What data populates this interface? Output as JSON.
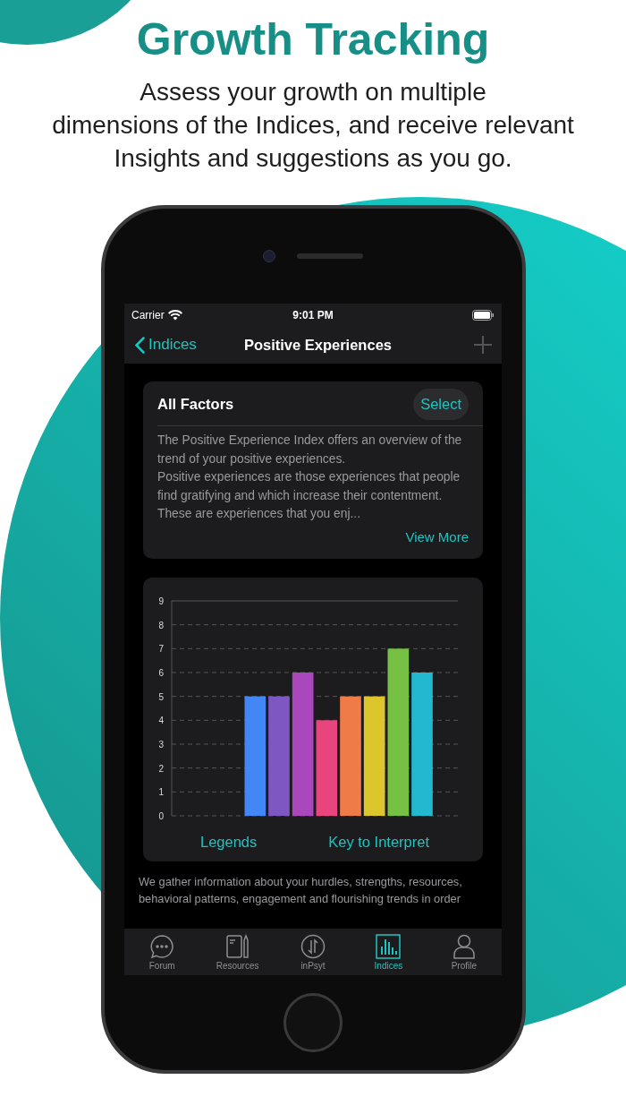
{
  "headline": "Growth Tracking",
  "subtitle_lines": [
    "Assess your growth on multiple",
    "dimensions of the Indices, and receive relevant",
    "Insights and suggestions as you go."
  ],
  "status_bar": {
    "carrier": "Carrier",
    "time": "9:01 PM"
  },
  "nav_bar": {
    "back": "Indices",
    "title": "Positive Experiences",
    "add_disabled": true
  },
  "factors_card": {
    "title": "All Factors",
    "select": "Select",
    "paragraphs": [
      "The Positive Experience Index offers an overview of the trend of your positive experiences.",
      "Positive experiences are those experiences that people find gratifying and which increase their contentment. These are experiences that you enj..."
    ],
    "view_more": "View More"
  },
  "chart_card": {
    "chart_data": {
      "type": "bar",
      "grid": true,
      "ylim": [
        0,
        9
      ],
      "yticks": [
        0,
        1,
        2,
        3,
        4,
        5,
        6,
        7,
        8,
        9
      ],
      "series": [
        {
          "color": "#4287f5",
          "values": [
            null,
            null,
            null,
            5,
            null,
            null,
            null,
            null,
            null,
            null,
            null,
            null
          ]
        },
        {
          "color": "#7e57c2",
          "values": [
            null,
            null,
            null,
            null,
            5,
            null,
            null,
            null,
            null,
            null,
            null,
            null
          ]
        },
        {
          "color": "#ab47bc",
          "values": [
            null,
            null,
            null,
            null,
            null,
            6,
            null,
            null,
            null,
            null,
            null,
            null
          ]
        },
        {
          "color": "#e8457f",
          "values": [
            null,
            null,
            null,
            null,
            null,
            null,
            4,
            null,
            null,
            null,
            null,
            null
          ]
        },
        {
          "color": "#ef7b48",
          "values": [
            null,
            null,
            null,
            null,
            null,
            null,
            null,
            5,
            null,
            null,
            null,
            null
          ]
        },
        {
          "color": "#dcc62c",
          "values": [
            null,
            null,
            null,
            null,
            null,
            null,
            null,
            null,
            5,
            null,
            null,
            null
          ]
        },
        {
          "color": "#76c043",
          "values": [
            null,
            null,
            null,
            null,
            null,
            null,
            null,
            null,
            null,
            7,
            null,
            null
          ]
        },
        {
          "color": "#22b8cf",
          "values": [
            null,
            null,
            null,
            null,
            null,
            null,
            null,
            null,
            null,
            null,
            6,
            null
          ]
        }
      ]
    },
    "links": [
      "Legends",
      "Key to Interpret"
    ]
  },
  "info_text": "We gather information about your hurdles, strengths, resources, behavioral patterns, engagement and flourishing trends in order",
  "tabs": [
    {
      "label": "Forum",
      "kind": "chat",
      "selected": false
    },
    {
      "label": "Resources",
      "kind": "notebook",
      "selected": false
    },
    {
      "label": "inPsyt",
      "kind": "arrows",
      "selected": false
    },
    {
      "label": "Indices",
      "kind": "bars",
      "selected": true
    },
    {
      "label": "Profile",
      "kind": "person",
      "selected": false
    }
  ]
}
